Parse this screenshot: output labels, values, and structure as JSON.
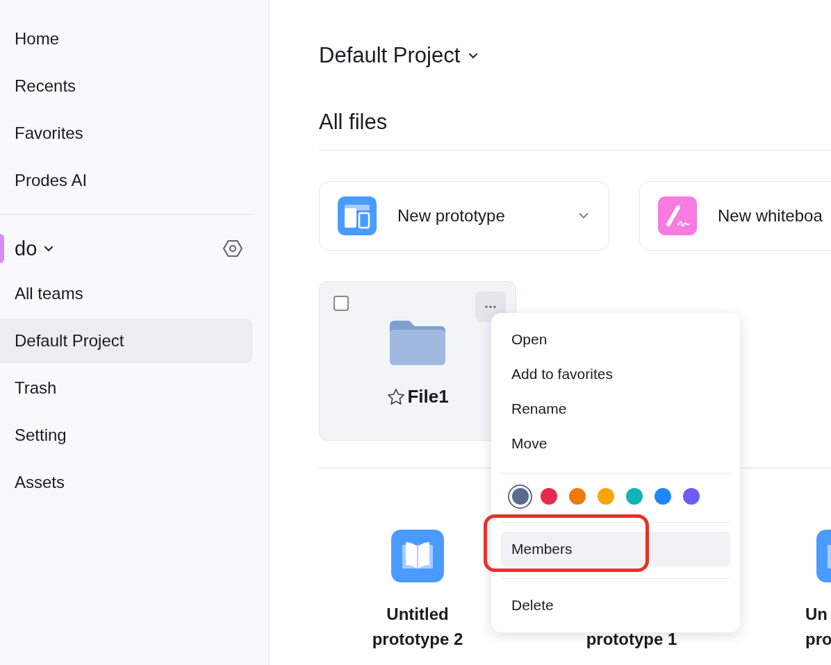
{
  "sidebar": {
    "top_items": [
      {
        "label": "Home",
        "selected": false
      },
      {
        "label": "Recents",
        "selected": false
      },
      {
        "label": "Favorites",
        "selected": false
      },
      {
        "label": "Prodes AI",
        "selected": false
      }
    ],
    "team": {
      "name": "do"
    },
    "team_items": [
      {
        "label": "All teams",
        "selected": false
      },
      {
        "label": "Default Project",
        "selected": true
      },
      {
        "label": "Trash",
        "selected": false
      },
      {
        "label": "Setting",
        "selected": false
      },
      {
        "label": "Assets",
        "selected": false
      }
    ]
  },
  "header": {
    "project": "Default Project",
    "section": "All files"
  },
  "new_cards": [
    {
      "kind": "prototype",
      "label": "New prototype"
    },
    {
      "kind": "whiteboard",
      "label": "New whiteboa"
    }
  ],
  "folder": {
    "name": "File1",
    "checked": false,
    "favorite": false
  },
  "files": [
    {
      "lines": [
        "Untitled",
        "prototype 2"
      ]
    },
    {
      "lines": [
        "prototype 1"
      ]
    },
    {
      "lines": [
        "Un",
        "pro"
      ]
    }
  ],
  "menu": {
    "items": [
      {
        "kind": "item",
        "label": "Open",
        "selected": false,
        "annotated": false
      },
      {
        "kind": "item",
        "label": "Add to favorites",
        "selected": false,
        "annotated": false
      },
      {
        "kind": "item",
        "label": "Rename",
        "selected": false,
        "annotated": false
      },
      {
        "kind": "item",
        "label": "Move",
        "selected": false,
        "annotated": false
      },
      {
        "kind": "divider"
      },
      {
        "kind": "colors",
        "colors": [
          {
            "color": "#5a6b8c",
            "selected": true
          },
          {
            "color": "#e8294f",
            "selected": false
          },
          {
            "color": "#ee7a0c",
            "selected": false
          },
          {
            "color": "#fba40a",
            "selected": false
          },
          {
            "color": "#0fb5b5",
            "selected": false
          },
          {
            "color": "#1f87f5",
            "selected": false
          },
          {
            "color": "#6d5cf5",
            "selected": false
          }
        ]
      },
      {
        "kind": "divider"
      },
      {
        "kind": "item",
        "label": "Members",
        "selected": true,
        "annotated": true
      },
      {
        "kind": "divider"
      },
      {
        "kind": "item",
        "label": "Delete",
        "selected": false,
        "annotated": false
      }
    ]
  }
}
